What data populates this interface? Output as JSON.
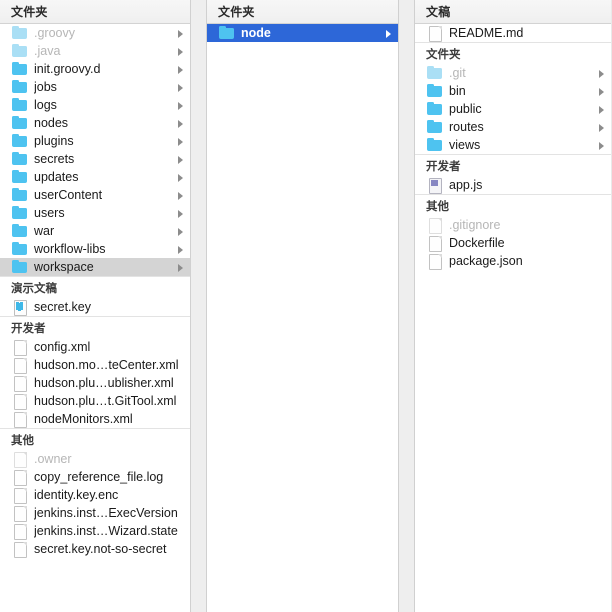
{
  "app": {
    "name": "Finder",
    "view": "column-view"
  },
  "colors": {
    "selection_active": "#2d67d8",
    "selection_inactive": "#d4d4d4",
    "folder_icon": "#4ec3f0",
    "folder_icon_hidden": "#aadff5",
    "header_bg": "#f3f3f3",
    "divider": "#d0d0d0"
  },
  "columns": [
    {
      "header": "文件夹",
      "groups": [
        {
          "title": null,
          "items": [
            {
              "name": ".groovy",
              "icon": "folder-icon",
              "hidden": true,
              "arrow": true,
              "selected": false
            },
            {
              "name": ".java",
              "icon": "folder-icon",
              "hidden": true,
              "arrow": true,
              "selected": false
            },
            {
              "name": "init.groovy.d",
              "icon": "folder-icon",
              "hidden": false,
              "arrow": true,
              "selected": false
            },
            {
              "name": "jobs",
              "icon": "folder-icon",
              "hidden": false,
              "arrow": true,
              "selected": false
            },
            {
              "name": "logs",
              "icon": "folder-icon",
              "hidden": false,
              "arrow": true,
              "selected": false
            },
            {
              "name": "nodes",
              "icon": "folder-icon",
              "hidden": false,
              "arrow": true,
              "selected": false
            },
            {
              "name": "plugins",
              "icon": "folder-icon",
              "hidden": false,
              "arrow": true,
              "selected": false
            },
            {
              "name": "secrets",
              "icon": "folder-icon",
              "hidden": false,
              "arrow": true,
              "selected": false
            },
            {
              "name": "updates",
              "icon": "folder-icon",
              "hidden": false,
              "arrow": true,
              "selected": false
            },
            {
              "name": "userContent",
              "icon": "folder-icon",
              "hidden": false,
              "arrow": true,
              "selected": false
            },
            {
              "name": "users",
              "icon": "folder-icon",
              "hidden": false,
              "arrow": true,
              "selected": false
            },
            {
              "name": "war",
              "icon": "folder-icon",
              "hidden": false,
              "arrow": true,
              "selected": false
            },
            {
              "name": "workflow-libs",
              "icon": "folder-icon",
              "hidden": false,
              "arrow": true,
              "selected": false
            },
            {
              "name": "workspace",
              "icon": "folder-icon",
              "hidden": false,
              "arrow": true,
              "selected": true,
              "selection": "inactive"
            }
          ]
        },
        {
          "title": "演示文稿",
          "items": [
            {
              "name": "secret.key",
              "icon": "key-icon",
              "hidden": false,
              "arrow": false,
              "selected": false
            }
          ]
        },
        {
          "title": "开发者",
          "items": [
            {
              "name": "config.xml",
              "icon": "document-icon",
              "hidden": false,
              "arrow": false,
              "selected": false
            },
            {
              "name": "hudson.mo…teCenter.xml",
              "icon": "document-icon",
              "hidden": false,
              "arrow": false,
              "selected": false
            },
            {
              "name": "hudson.plu…ublisher.xml",
              "icon": "document-icon",
              "hidden": false,
              "arrow": false,
              "selected": false
            },
            {
              "name": "hudson.plu…t.GitTool.xml",
              "icon": "document-icon",
              "hidden": false,
              "arrow": false,
              "selected": false
            },
            {
              "name": "nodeMonitors.xml",
              "icon": "document-icon",
              "hidden": false,
              "arrow": false,
              "selected": false
            }
          ]
        },
        {
          "title": "其他",
          "items": [
            {
              "name": ".owner",
              "icon": "document-icon",
              "hidden": true,
              "arrow": false,
              "selected": false
            },
            {
              "name": "copy_reference_file.log",
              "icon": "document-icon",
              "hidden": false,
              "arrow": false,
              "selected": false
            },
            {
              "name": "identity.key.enc",
              "icon": "document-icon",
              "hidden": false,
              "arrow": false,
              "selected": false
            },
            {
              "name": "jenkins.inst…ExecVersion",
              "icon": "document-icon",
              "hidden": false,
              "arrow": false,
              "selected": false
            },
            {
              "name": "jenkins.inst…Wizard.state",
              "icon": "document-icon",
              "hidden": false,
              "arrow": false,
              "selected": false
            },
            {
              "name": "secret.key.not-so-secret",
              "icon": "document-icon",
              "hidden": false,
              "arrow": false,
              "selected": false
            }
          ]
        }
      ]
    },
    {
      "header": "文件夹",
      "groups": [
        {
          "title": null,
          "items": [
            {
              "name": "node",
              "icon": "folder-icon",
              "hidden": false,
              "arrow": true,
              "selected": true,
              "selection": "active"
            }
          ]
        }
      ]
    },
    {
      "header": "文稿",
      "groups": [
        {
          "title": null,
          "items": [
            {
              "name": "README.md",
              "icon": "document-icon",
              "hidden": false,
              "arrow": false,
              "selected": false
            }
          ]
        },
        {
          "title": "文件夹",
          "items": [
            {
              "name": ".git",
              "icon": "folder-icon",
              "hidden": true,
              "arrow": true,
              "selected": false
            },
            {
              "name": "bin",
              "icon": "folder-icon",
              "hidden": false,
              "arrow": true,
              "selected": false
            },
            {
              "name": "public",
              "icon": "folder-icon",
              "hidden": false,
              "arrow": true,
              "selected": false
            },
            {
              "name": "routes",
              "icon": "folder-icon",
              "hidden": false,
              "arrow": true,
              "selected": false
            },
            {
              "name": "views",
              "icon": "folder-icon",
              "hidden": false,
              "arrow": true,
              "selected": false
            }
          ]
        },
        {
          "title": "开发者",
          "items": [
            {
              "name": "app.js",
              "icon": "js-icon",
              "hidden": false,
              "arrow": false,
              "selected": false
            }
          ]
        },
        {
          "title": "其他",
          "items": [
            {
              "name": ".gitignore",
              "icon": "document-icon",
              "hidden": true,
              "arrow": false,
              "selected": false
            },
            {
              "name": "Dockerfile",
              "icon": "document-icon",
              "hidden": false,
              "arrow": false,
              "selected": false
            },
            {
              "name": "package.json",
              "icon": "document-icon",
              "hidden": false,
              "arrow": false,
              "selected": false
            }
          ]
        }
      ]
    }
  ]
}
